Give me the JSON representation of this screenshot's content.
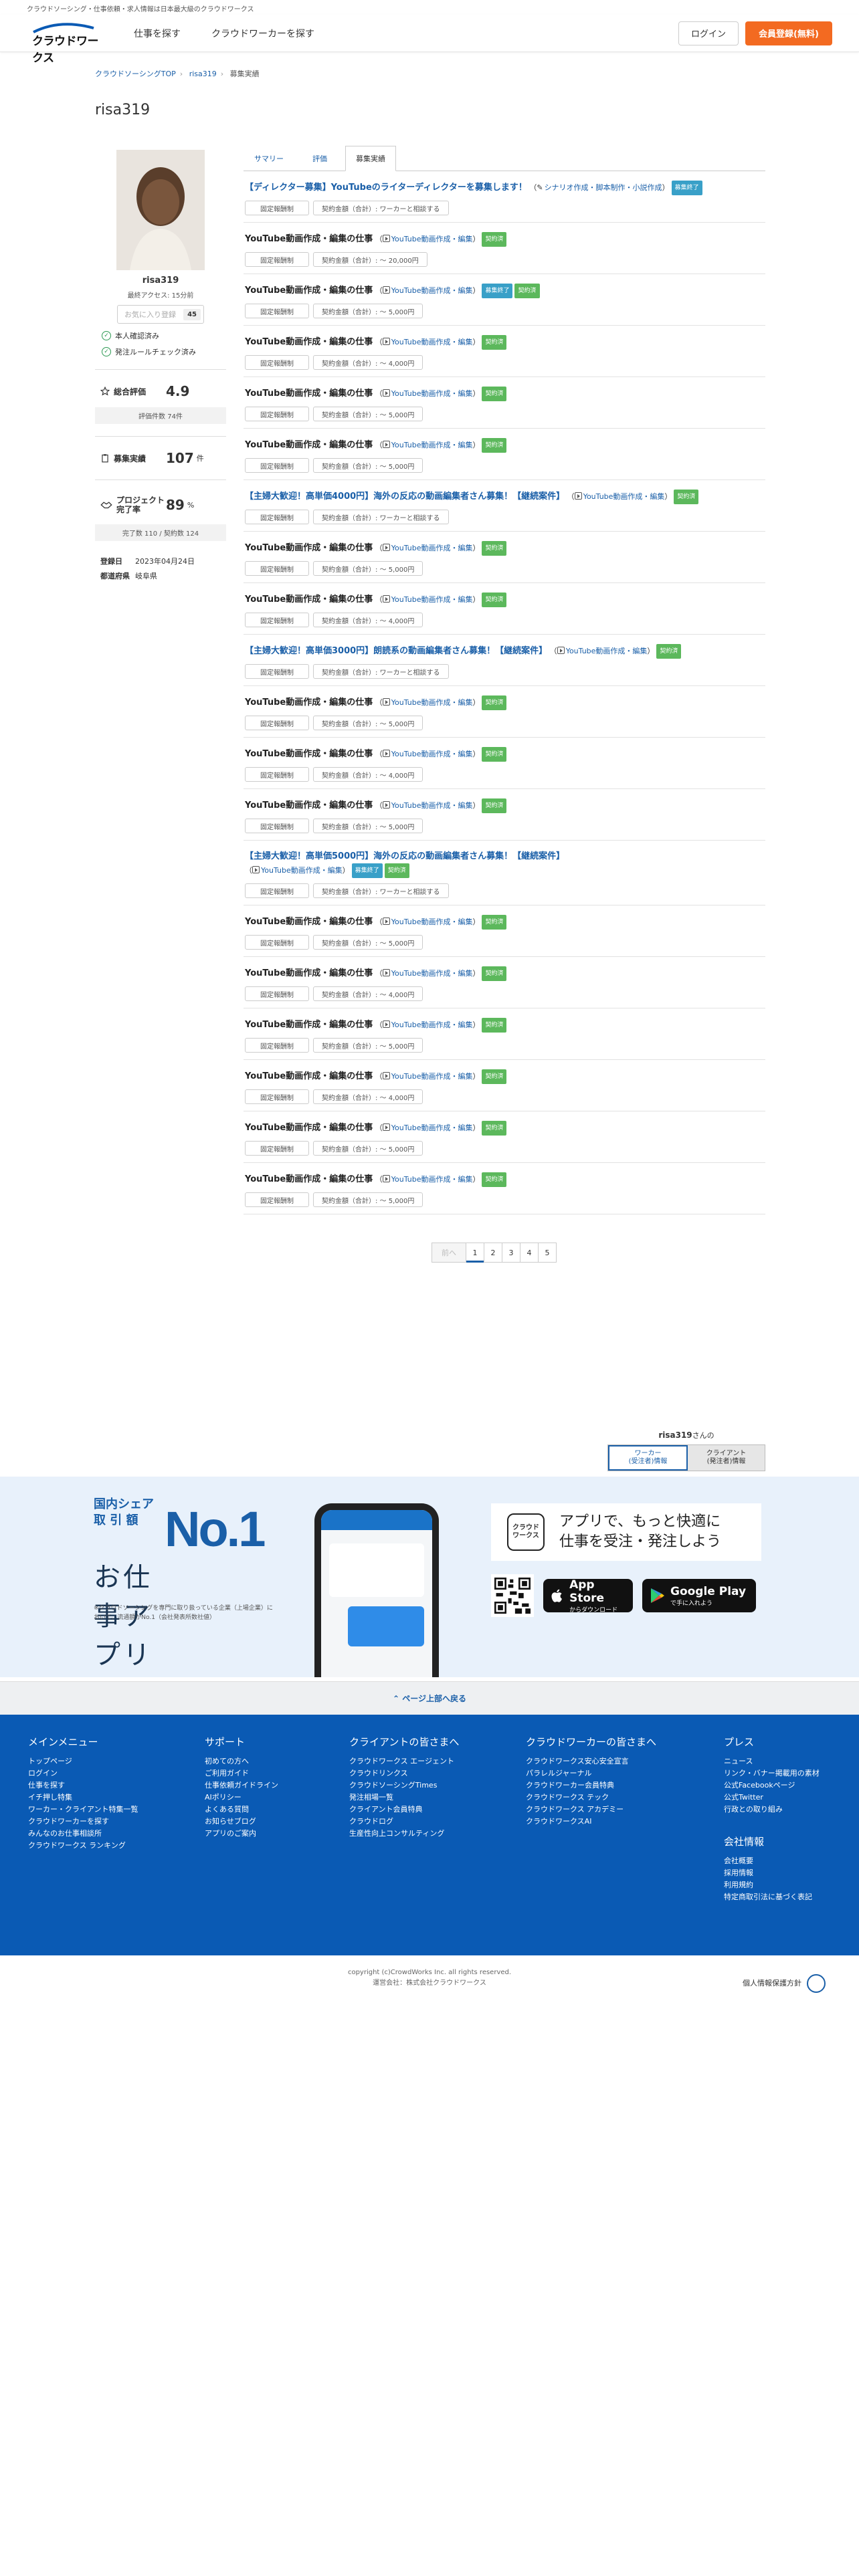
{
  "top_strip": "クラウドソーシング・仕事依頼・求人情報は日本最大級のクラウドワークス",
  "header": {
    "logo": "クラウドワークス",
    "nav": [
      "仕事を探す",
      "クラウドワーカーを探す"
    ],
    "login": "ログイン",
    "register": "会員登録(無料)"
  },
  "breadcrumb": [
    "クラウドソーシングTOP",
    "risa319",
    "募集実績"
  ],
  "page_title": "risa319",
  "profile": {
    "name": "risa319",
    "last_access": "最終アクセス: 15分前",
    "follow_label": "お気に入り登録",
    "follow_count": "45",
    "checks": [
      "本人確認済み",
      "発注ルールチェック済み"
    ],
    "rating_label": "総合評価",
    "rating_value": "4.9",
    "rating_sub": "評価件数 74件",
    "orders_label": "募集実績",
    "orders_value": "107",
    "orders_unit": "件",
    "completion_label_1": "プロジェクト",
    "completion_label_2": "完了率",
    "completion_value": "89",
    "completion_unit": "%",
    "completion_sub": "完了数 110 / 契約数 124",
    "registered_key": "登録日",
    "registered_val": "2023年04月24日",
    "prefecture_key": "都道府県",
    "prefecture_val": "岐阜県"
  },
  "tabs": [
    "サマリー",
    "評価",
    "募集実績"
  ],
  "jobs": [
    {
      "title": "【ディレクター募集】YouTubeのライターディレクターを募集します！",
      "link": true,
      "category": "シナリオ作成・脚本制作・小説作成",
      "icon": "pen-icon",
      "badges": [
        {
          "t": "募集終了",
          "c": "blue"
        }
      ],
      "type": "固定報酬制",
      "amount": "契約金額（合計）: ワーカーと相談する"
    },
    {
      "title": "YouTube動画作成・編集の仕事",
      "link": false,
      "category": "YouTube動画作成・編集",
      "icon": "video-icon",
      "badges": [
        {
          "t": "契約済",
          "c": "green"
        }
      ],
      "type": "固定報酬制",
      "amount": "契約金額（合計）: 〜 20,000円"
    },
    {
      "title": "YouTube動画作成・編集の仕事",
      "link": false,
      "category": "YouTube動画作成・編集",
      "icon": "video-icon",
      "badges": [
        {
          "t": "募集終了",
          "c": "blue"
        },
        {
          "t": "契約済",
          "c": "green"
        }
      ],
      "type": "固定報酬制",
      "amount": "契約金額（合計）: 〜 5,000円"
    },
    {
      "title": "YouTube動画作成・編集の仕事",
      "link": false,
      "category": "YouTube動画作成・編集",
      "icon": "video-icon",
      "badges": [
        {
          "t": "契約済",
          "c": "green"
        }
      ],
      "type": "固定報酬制",
      "amount": "契約金額（合計）: 〜 4,000円"
    },
    {
      "title": "YouTube動画作成・編集の仕事",
      "link": false,
      "category": "YouTube動画作成・編集",
      "icon": "video-icon",
      "badges": [
        {
          "t": "契約済",
          "c": "green"
        }
      ],
      "type": "固定報酬制",
      "amount": "契約金額（合計）: 〜 5,000円"
    },
    {
      "title": "YouTube動画作成・編集の仕事",
      "link": false,
      "category": "YouTube動画作成・編集",
      "icon": "video-icon",
      "badges": [
        {
          "t": "契約済",
          "c": "green"
        }
      ],
      "type": "固定報酬制",
      "amount": "契約金額（合計）: 〜 5,000円"
    },
    {
      "title": "【主婦大歓迎！高単価4000円】海外の反応の動画編集者さん募集！【継続案件】",
      "link": true,
      "category": "YouTube動画作成・編集",
      "icon": "video-icon",
      "badges": [
        {
          "t": "契約済",
          "c": "green"
        }
      ],
      "type": "固定報酬制",
      "amount": "契約金額（合計）: ワーカーと相談する"
    },
    {
      "title": "YouTube動画作成・編集の仕事",
      "link": false,
      "category": "YouTube動画作成・編集",
      "icon": "video-icon",
      "badges": [
        {
          "t": "契約済",
          "c": "green"
        }
      ],
      "type": "固定報酬制",
      "amount": "契約金額（合計）: 〜 5,000円"
    },
    {
      "title": "YouTube動画作成・編集の仕事",
      "link": false,
      "category": "YouTube動画作成・編集",
      "icon": "video-icon",
      "badges": [
        {
          "t": "契約済",
          "c": "green"
        }
      ],
      "type": "固定報酬制",
      "amount": "契約金額（合計）: 〜 4,000円"
    },
    {
      "title": "【主婦大歓迎！高単価3000円】朗読系の動画編集者さん募集！【継続案件】",
      "link": true,
      "category": "YouTube動画作成・編集",
      "icon": "video-icon",
      "badges": [
        {
          "t": "契約済",
          "c": "green"
        }
      ],
      "type": "固定報酬制",
      "amount": "契約金額（合計）: ワーカーと相談する"
    },
    {
      "title": "YouTube動画作成・編集の仕事",
      "link": false,
      "category": "YouTube動画作成・編集",
      "icon": "video-icon",
      "badges": [
        {
          "t": "契約済",
          "c": "green"
        }
      ],
      "type": "固定報酬制",
      "amount": "契約金額（合計）: 〜 5,000円"
    },
    {
      "title": "YouTube動画作成・編集の仕事",
      "link": false,
      "category": "YouTube動画作成・編集",
      "icon": "video-icon",
      "badges": [
        {
          "t": "契約済",
          "c": "green"
        }
      ],
      "type": "固定報酬制",
      "amount": "契約金額（合計）: 〜 4,000円"
    },
    {
      "title": "YouTube動画作成・編集の仕事",
      "link": false,
      "category": "YouTube動画作成・編集",
      "icon": "video-icon",
      "badges": [
        {
          "t": "契約済",
          "c": "green"
        }
      ],
      "type": "固定報酬制",
      "amount": "契約金額（合計）: 〜 5,000円"
    },
    {
      "title": "【主婦大歓迎！高単価5000円】海外の反応の動画編集者さん募集！【継続案件】",
      "link": true,
      "wrap": true,
      "category": "YouTube動画作成・編集",
      "icon": "video-icon",
      "badges": [
        {
          "t": "募集終了",
          "c": "blue"
        },
        {
          "t": "契約済",
          "c": "green"
        }
      ],
      "type": "固定報酬制",
      "amount": "契約金額（合計）: ワーカーと相談する"
    },
    {
      "title": "YouTube動画作成・編集の仕事",
      "link": false,
      "category": "YouTube動画作成・編集",
      "icon": "video-icon",
      "badges": [
        {
          "t": "契約済",
          "c": "green"
        }
      ],
      "type": "固定報酬制",
      "amount": "契約金額（合計）: 〜 5,000円"
    },
    {
      "title": "YouTube動画作成・編集の仕事",
      "link": false,
      "category": "YouTube動画作成・編集",
      "icon": "video-icon",
      "badges": [
        {
          "t": "契約済",
          "c": "green"
        }
      ],
      "type": "固定報酬制",
      "amount": "契約金額（合計）: 〜 4,000円"
    },
    {
      "title": "YouTube動画作成・編集の仕事",
      "link": false,
      "category": "YouTube動画作成・編集",
      "icon": "video-icon",
      "badges": [
        {
          "t": "契約済",
          "c": "green"
        }
      ],
      "type": "固定報酬制",
      "amount": "契約金額（合計）: 〜 5,000円"
    },
    {
      "title": "YouTube動画作成・編集の仕事",
      "link": false,
      "category": "YouTube動画作成・編集",
      "icon": "video-icon",
      "badges": [
        {
          "t": "契約済",
          "c": "green"
        }
      ],
      "type": "固定報酬制",
      "amount": "契約金額（合計）: 〜 4,000円"
    },
    {
      "title": "YouTube動画作成・編集の仕事",
      "link": false,
      "category": "YouTube動画作成・編集",
      "icon": "video-icon",
      "badges": [
        {
          "t": "契約済",
          "c": "green"
        }
      ],
      "type": "固定報酬制",
      "amount": "契約金額（合計）: 〜 5,000円"
    },
    {
      "title": "YouTube動画作成・編集の仕事",
      "link": false,
      "category": "YouTube動画作成・編集",
      "icon": "video-icon",
      "badges": [
        {
          "t": "契約済",
          "c": "green"
        }
      ],
      "type": "固定報酬制",
      "amount": "契約金額（合計）: 〜 5,000円"
    }
  ],
  "pagination": {
    "prev": "前へ",
    "pages": [
      "1",
      "2",
      "3",
      "4",
      "5"
    ],
    "current": "1"
  },
  "switcher": {
    "name": "risa319",
    "suffix": "さんの",
    "worker": "ワーカー\n(受注者)情報",
    "client": "クライアント\n(発注者)情報"
  },
  "app": {
    "share": "国内シェア\n取 引 額",
    "no1": "No.1",
    "title": "お仕事アプリ",
    "note": "※クラウドソーシングを専門に取り扱っている企業（上場企業）において、流通額がNo.1（会社発表所数社値）",
    "icon_text": "クラウド\nワークス",
    "tagline": "アプリで、もっと快適に\n仕事を受注・発注しよう",
    "appstore_small": "Download on the",
    "appstore_big": "App Store",
    "appstore_sub": "からダウンロード",
    "google_small": "GET IT ON",
    "google_big": "Google Play",
    "google_sub": "で手に入れよう"
  },
  "back_top": "⌃ ページ上部へ戻る",
  "footer": {
    "cols": [
      {
        "title": "メインメニュー",
        "items": [
          "トップページ",
          "ログイン",
          "仕事を探す",
          "イチ押し特集",
          "ワーカー・クライアント特集一覧",
          "クラウドワーカーを探す",
          "みんなのお仕事相談所",
          "クラウドワークス ランキング"
        ]
      },
      {
        "title": "サポート",
        "items": [
          "初めての方へ",
          "ご利用ガイド",
          "仕事依頼ガイドライン",
          "AIポリシー",
          "よくある質問",
          "お知らせブログ",
          "アプリのご案内"
        ]
      },
      {
        "title": "クライアントの皆さまへ",
        "items": [
          "クラウドワークス エージェント",
          "クラウドリンクス",
          "クラウドソーシングTimes",
          "発注相場一覧",
          "クライアント会員特典",
          "クラウドログ",
          "生産性向上コンサルティング"
        ]
      },
      {
        "title": "クラウドワーカーの皆さまへ",
        "items": [
          "クラウドワークス安心安全宣言",
          "パラレルジャーナル",
          "クラウドワーカー会員特典",
          "クラウドワークス テック",
          "クラウドワークス アカデミー",
          "クラウドワークスAI"
        ]
      },
      {
        "title": "プレス",
        "items": [
          "ニュース",
          "リンク・バナー掲載用の素材",
          "公式Facebookページ",
          "公式Twitter",
          "行政との取り組み"
        ],
        "title2": "会社情報",
        "items2": [
          "会社概要",
          "採用情報",
          "利用規約",
          "特定商取引法に基づく表記"
        ]
      }
    ],
    "copyright": "copyright (c)CrowdWorks Inc. all rights reserved.",
    "operator": "運営会社：株式会社クラウドワークス",
    "privacy": "個人情報保護方針"
  },
  "colors": {
    "brand_blue": "#1a5fa8",
    "orange": "#f36a21",
    "footer_blue": "#0a5ab4",
    "badge_blue": "#39a0c8",
    "badge_green": "#5cb85c"
  }
}
